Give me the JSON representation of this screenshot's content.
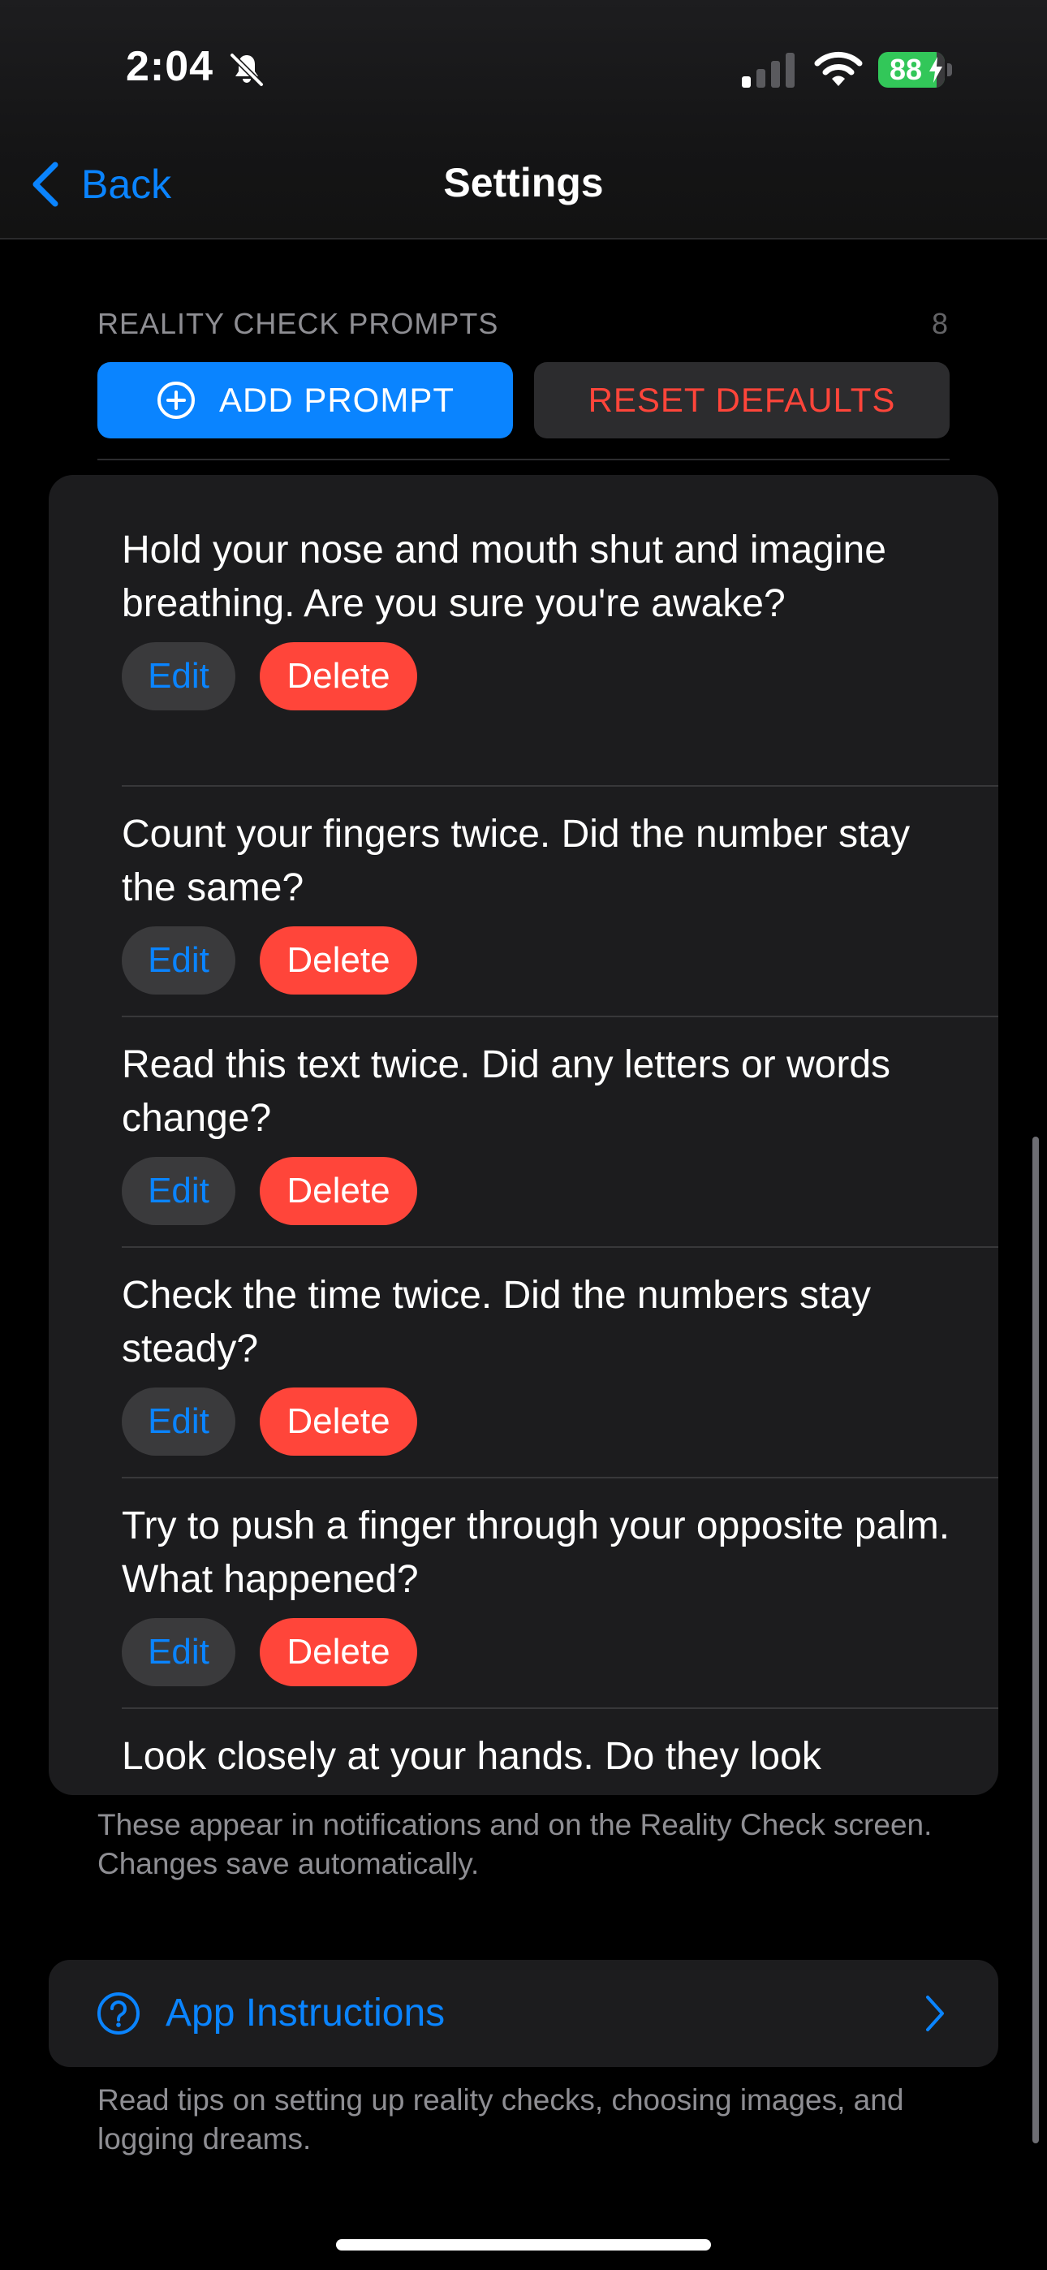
{
  "status_bar": {
    "time": "2:04",
    "battery_percent": "88"
  },
  "nav": {
    "back_label": "Back",
    "title": "Settings"
  },
  "section": {
    "header": "REALITY CHECK PROMPTS",
    "count": "8",
    "add_label": "ADD PROMPT",
    "reset_label": "RESET DEFAULTS"
  },
  "prompts": [
    {
      "text": "Hold your nose and mouth shut and imagine breathing. Are you sure you're awake?",
      "edit": "Edit",
      "delete": "Delete"
    },
    {
      "text": "Count your fingers twice. Did the number stay the same?",
      "edit": "Edit",
      "delete": "Delete"
    },
    {
      "text": "Read this text twice. Did any letters or words change?",
      "edit": "Edit",
      "delete": "Delete"
    },
    {
      "text": "Check the time twice. Did the numbers stay steady?",
      "edit": "Edit",
      "delete": "Delete"
    },
    {
      "text": "Try to push a finger through your opposite palm. What happened?",
      "edit": "Edit",
      "delete": "Delete"
    },
    {
      "text": "Look closely at your hands. Do they look"
    }
  ],
  "card_footer": "These appear in notifications and on the Reality Check screen. Changes save automatically.",
  "instructions": {
    "label": "App Instructions",
    "footer": "Read tips on setting up reality checks, choosing images, and logging dreams."
  },
  "colors": {
    "accent_blue": "#0a84ff",
    "destructive_red": "#ff453a",
    "battery_green": "#32c759",
    "card_background": "#1c1c1e"
  },
  "icons": [
    "bell-slash-icon",
    "cellular-signal-icon",
    "wifi-icon",
    "battery-icon",
    "back-chevron-icon",
    "plus-circle-icon",
    "question-circle-icon",
    "chevron-right-icon"
  ]
}
